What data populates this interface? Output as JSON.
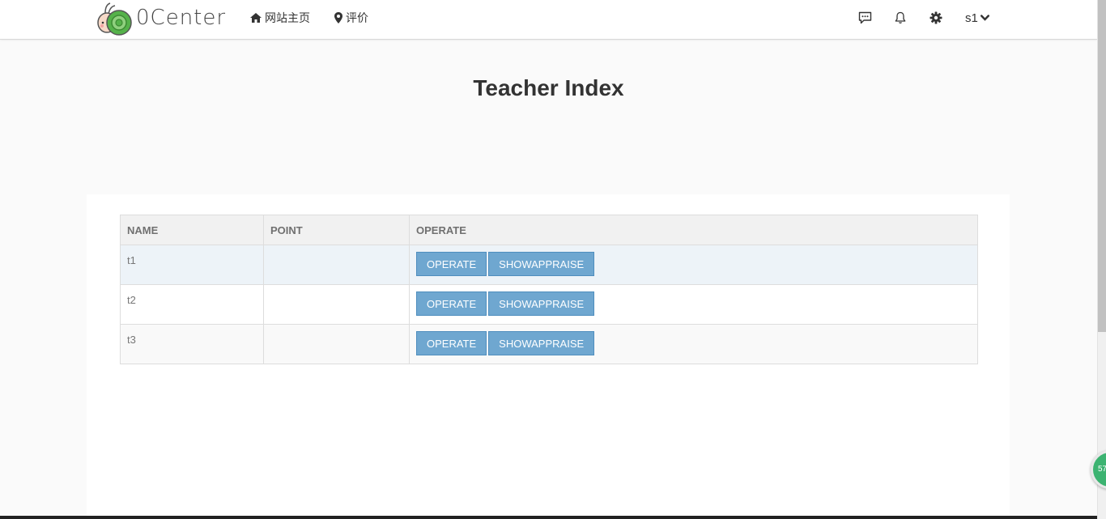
{
  "header": {
    "brand": "0Center",
    "nav": [
      {
        "label": "网站主页",
        "icon": "home-icon"
      },
      {
        "label": "评价",
        "icon": "map-marker-icon"
      }
    ],
    "right_icons": [
      "comment-icon",
      "bell-icon",
      "gear-icon"
    ],
    "user": "s1"
  },
  "page": {
    "title": "Teacher Index"
  },
  "table": {
    "columns": [
      "NAME",
      "POINT",
      "OPERATE"
    ],
    "rows": [
      {
        "name": "t1",
        "point": "",
        "actions": [
          "OPERATE",
          "SHOWAPPRAISE"
        ]
      },
      {
        "name": "t2",
        "point": "",
        "actions": [
          "OPERATE",
          "SHOWAPPRAISE"
        ]
      },
      {
        "name": "t3",
        "point": "",
        "actions": [
          "OPERATE",
          "SHOWAPPRAISE"
        ]
      }
    ]
  },
  "floating_badge": "57",
  "colors": {
    "accent_button": "#6fa7d0",
    "header_bg": "#ffffff",
    "page_bg": "#fafafa"
  }
}
